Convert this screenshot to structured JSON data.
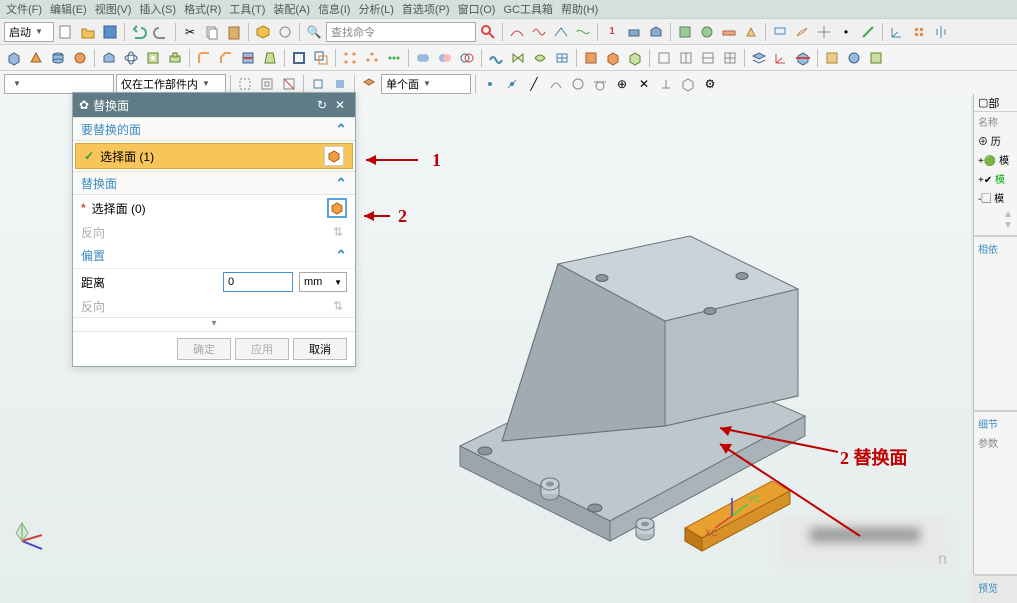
{
  "menubar": {
    "items": [
      "文件(F)",
      "编辑(E)",
      "视图(V)",
      "插入(S)",
      "格式(R)",
      "工具(T)",
      "装配(A)",
      "信息(I)",
      "分析(L)",
      "首选项(P)",
      "窗口(O)",
      "GC工具箱",
      "帮助(H)"
    ]
  },
  "toolbar1": {
    "launch_label": "启动",
    "search_placeholder": "查找命令"
  },
  "toolbar3": {
    "scope_label": "仅在工作部件内",
    "single_face_label": "单个面"
  },
  "dialog": {
    "title": "替换面",
    "section1_title": "要替换的面",
    "row1_check": "✓",
    "row1_label": "选择面 (1)",
    "section2_title": "替换面",
    "row2_star": "*",
    "row2_label": "选择面 (0)",
    "reverse1_label": "反向",
    "offset_title": "偏置",
    "distance_label": "距离",
    "distance_value": "0",
    "distance_unit": "mm",
    "reverse2_label": "反向",
    "btn_ok": "确定",
    "btn_apply": "应用",
    "btn_cancel": "取消"
  },
  "annotations": {
    "a1": "1",
    "a2": "2",
    "a3": "2  替换面"
  },
  "axes": {
    "xc": "XC",
    "yc": "YC"
  },
  "rightbar": {
    "tab1": "部",
    "label_name": "名称",
    "item_hist": "历",
    "item_model1": "模",
    "item_model2": "模",
    "item_model3": "模",
    "section_dep": "相依",
    "section_detail": "细节",
    "label_param": "参数",
    "section_preview": "预览"
  },
  "triad_text": "n"
}
